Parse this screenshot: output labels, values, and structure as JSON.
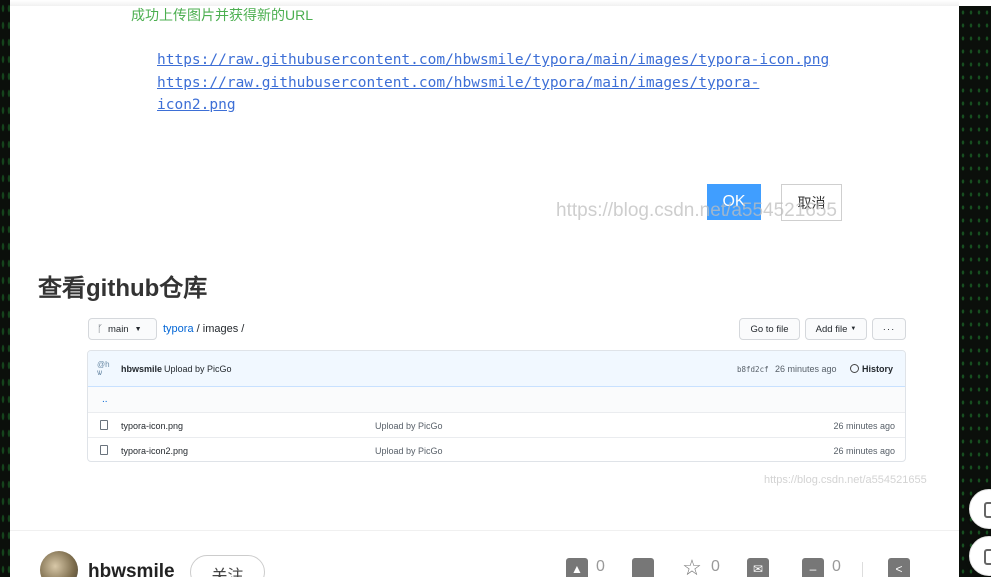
{
  "dialog": {
    "success_text": "成功上传图片并获得新的URL",
    "url_line1": "https://raw.githubusercontent.com/hbwsmile/typora/main/images/typora-icon.png",
    "url_line2": "https://raw.githubusercontent.com/hbwsmile/typora/main/images/typora-",
    "url_line3": "icon2.png",
    "ok_label": "OK",
    "cancel_label": "取消",
    "watermark": "https://blog.csdn.net/a554521655"
  },
  "section_title": "查看github仓库",
  "github": {
    "branch": "main",
    "path_repo": "typora",
    "path_sep1": " / ",
    "path_dir": "images",
    "path_sep2": " /",
    "goto_file": "Go to file",
    "add_file": "Add file",
    "more": "···",
    "commit": {
      "author": "hbwsmile",
      "message": "Upload by PicGo",
      "hash": "b8fd2cf",
      "time": "26 minutes ago",
      "history": "History"
    },
    "parent_dir": "..",
    "files": [
      {
        "name": "typora-icon.png",
        "message": "Upload by PicGo",
        "time": "26 minutes ago"
      },
      {
        "name": "typora-icon2.png",
        "message": "Upload by PicGo",
        "time": "26 minutes ago"
      }
    ],
    "watermark": "https://blog.csdn.net/a554521655"
  },
  "bottom_bar": {
    "username": "hbwsmile",
    "follow_label": "关注",
    "like_count": "0",
    "star_count": "0",
    "comment_count": "0",
    "icons": [
      "thumbs-up-icon",
      "comment-icon",
      "star-icon",
      "share-icon",
      "message-icon",
      "share-alt-icon"
    ]
  },
  "colors": {
    "ok_button": "#409eff",
    "success_text": "#4caf50",
    "link": "#3d6fd6",
    "github_link": "#0366d6"
  }
}
